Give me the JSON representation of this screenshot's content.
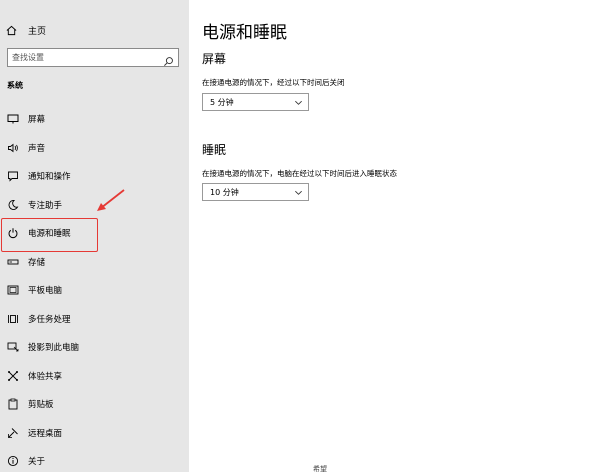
{
  "sidebar": {
    "home_label": "主页",
    "search_placeholder": "查找设置",
    "section_label": "系统",
    "items": [
      {
        "label": "屏幕",
        "icon": "monitor-icon"
      },
      {
        "label": "声音",
        "icon": "speaker-icon"
      },
      {
        "label": "通知和操作",
        "icon": "notification-icon"
      },
      {
        "label": "专注助手",
        "icon": "moon-icon"
      },
      {
        "label": "电源和睡眠",
        "icon": "power-icon"
      },
      {
        "label": "存储",
        "icon": "storage-icon"
      },
      {
        "label": "平板电脑",
        "icon": "tablet-icon"
      },
      {
        "label": "多任务处理",
        "icon": "multitask-icon"
      },
      {
        "label": "投影到此电脑",
        "icon": "project-icon"
      },
      {
        "label": "体验共享",
        "icon": "share-icon"
      },
      {
        "label": "剪贴板",
        "icon": "clipboard-icon"
      },
      {
        "label": "远程桌面",
        "icon": "remote-desktop-icon"
      },
      {
        "label": "关于",
        "icon": "info-icon"
      }
    ]
  },
  "main": {
    "title": "电源和睡眠",
    "screen": {
      "heading": "屏幕",
      "description": "在接通电源的情况下，经过以下时间后关闭",
      "value": "5 分钟"
    },
    "sleep": {
      "heading": "睡眠",
      "description": "在接通电源的情况下，电脑在经过以下时间后进入睡眠状态",
      "value": "10 分钟"
    },
    "bottom_fragment": "希望"
  },
  "colors": {
    "sidebar_bg": "#e6e6e6",
    "annotation_red": "#e53935"
  }
}
